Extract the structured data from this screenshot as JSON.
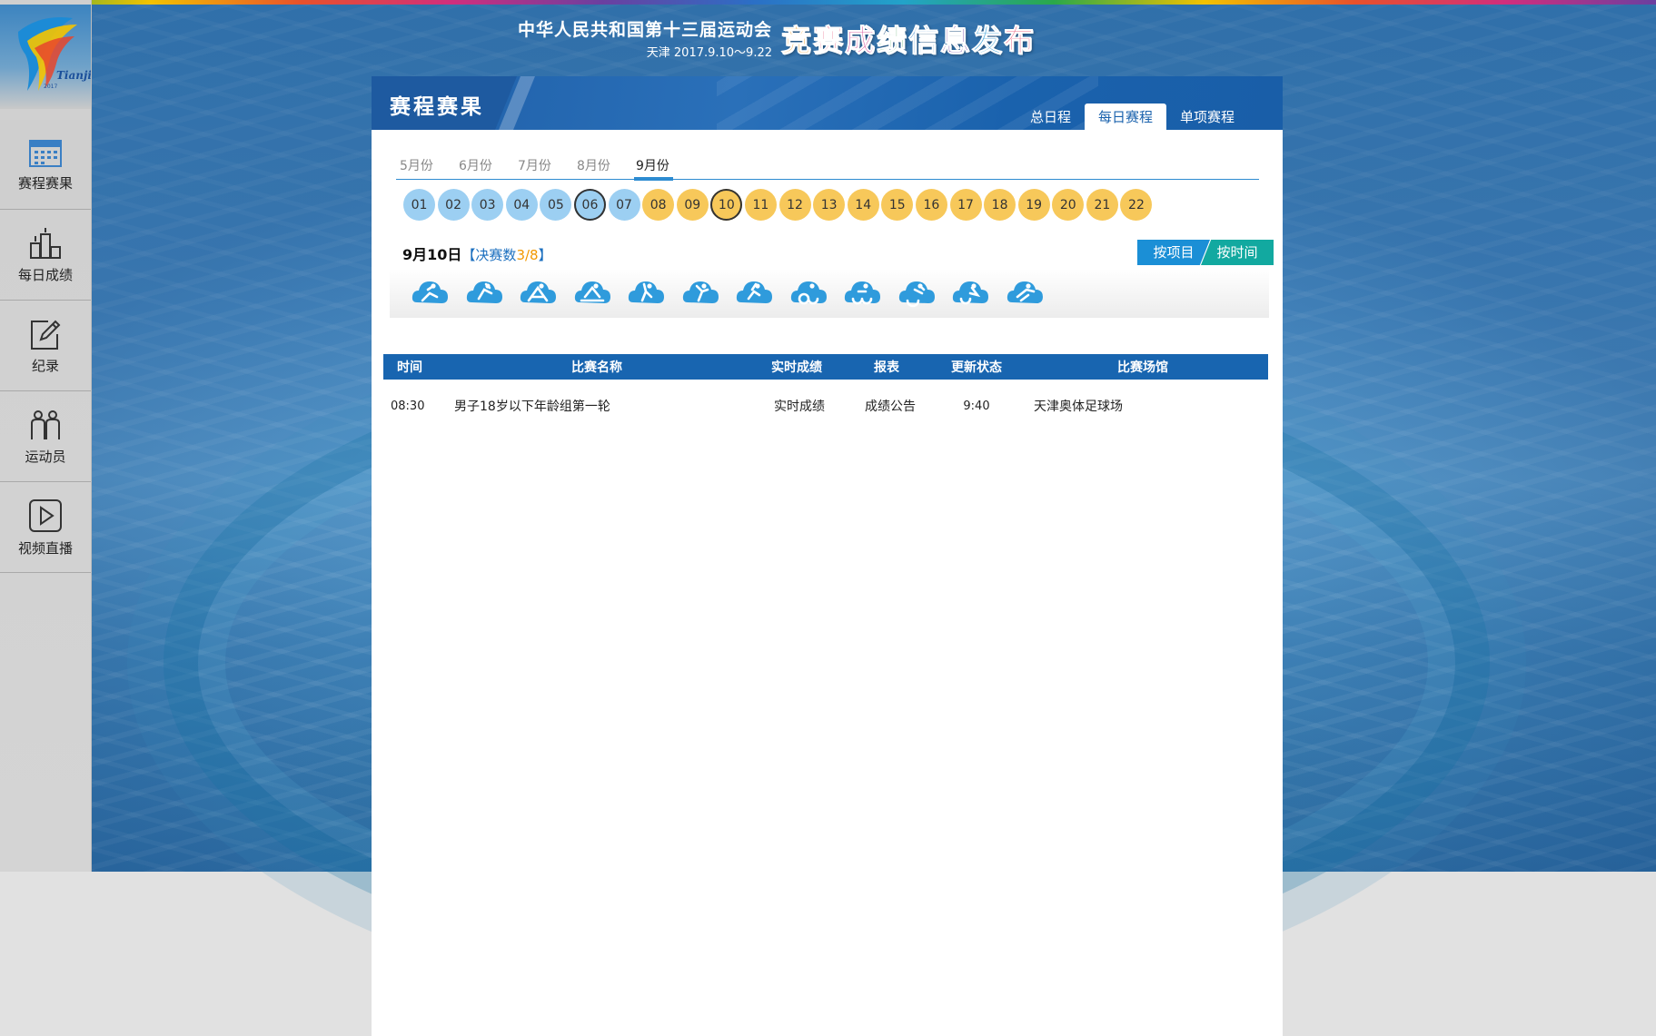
{
  "header": {
    "title": "中华人民共和国第十三届运动会",
    "subtitle": "天津 2017.9.10～9.22",
    "slogan": [
      "竞",
      "赛",
      "成",
      "绩",
      "信",
      "息",
      "发",
      "布"
    ],
    "slogan_colors": [
      "#f29a1a",
      "#e2315b",
      "#d0338a",
      "#2b9a3e",
      "#2a7cc6",
      "#6d3fa0",
      "#3aa0d8",
      "#e2315b"
    ]
  },
  "sidebar": {
    "items": [
      {
        "label": "赛程赛果",
        "icon": "calendar-icon"
      },
      {
        "label": "每日成绩",
        "icon": "podium-icon"
      },
      {
        "label": "纪录",
        "icon": "edit-record-icon"
      },
      {
        "label": "运动员",
        "icon": "athletes-icon"
      },
      {
        "label": "视频直播",
        "icon": "play-video-icon"
      }
    ]
  },
  "panel": {
    "title": "赛程赛果",
    "tabs": [
      "总日程",
      "每日赛程",
      "单项赛程"
    ],
    "active_tab": "每日赛程"
  },
  "months": [
    "5月份",
    "6月份",
    "7月份",
    "8月份",
    "9月份"
  ],
  "active_month": "9月份",
  "days": [
    {
      "label": "01",
      "color": "blue"
    },
    {
      "label": "02",
      "color": "blue"
    },
    {
      "label": "03",
      "color": "blue"
    },
    {
      "label": "04",
      "color": "blue"
    },
    {
      "label": "05",
      "color": "blue"
    },
    {
      "label": "06",
      "color": "blue",
      "ring": true
    },
    {
      "label": "07",
      "color": "blue"
    },
    {
      "label": "08",
      "color": "yellow"
    },
    {
      "label": "09",
      "color": "yellow"
    },
    {
      "label": "10",
      "color": "yellow",
      "ring": true
    },
    {
      "label": "11",
      "color": "yellow"
    },
    {
      "label": "12",
      "color": "yellow"
    },
    {
      "label": "13",
      "color": "yellow"
    },
    {
      "label": "14",
      "color": "yellow"
    },
    {
      "label": "15",
      "color": "yellow"
    },
    {
      "label": "16",
      "color": "yellow"
    },
    {
      "label": "17",
      "color": "yellow"
    },
    {
      "label": "18",
      "color": "yellow"
    },
    {
      "label": "19",
      "color": "yellow"
    },
    {
      "label": "20",
      "color": "yellow"
    },
    {
      "label": "21",
      "color": "yellow"
    },
    {
      "label": "22",
      "color": "yellow"
    }
  ],
  "date_line": {
    "date": "9月10日",
    "open_bracket": "【",
    "count_label": "决赛数",
    "count": "3/8",
    "close_bracket": "】"
  },
  "view_buttons": [
    "按项目",
    "按时间"
  ],
  "sports": [
    "sport-icon-1",
    "sport-icon-2",
    "sport-icon-3",
    "sport-icon-4",
    "sport-icon-5",
    "sport-icon-6",
    "sport-icon-7",
    "sport-icon-8",
    "sport-icon-9",
    "sport-icon-10",
    "sport-icon-11",
    "sport-icon-12"
  ],
  "table": {
    "headers": [
      "时间",
      "比赛名称",
      "实时成绩",
      "报表",
      "更新状态",
      "比赛场馆"
    ],
    "rows": [
      [
        "08:30",
        "男子18岁以下年龄组第一轮",
        "实时成绩",
        "成绩公告",
        "9:40",
        "天津奥体足球场"
      ]
    ]
  },
  "colors": {
    "accent_blue": "#1865b0",
    "day_blue": "#9ccff2",
    "day_yellow": "#f7c85a",
    "count_orange": "#f29800",
    "btn_teal": "#12a9a0"
  }
}
